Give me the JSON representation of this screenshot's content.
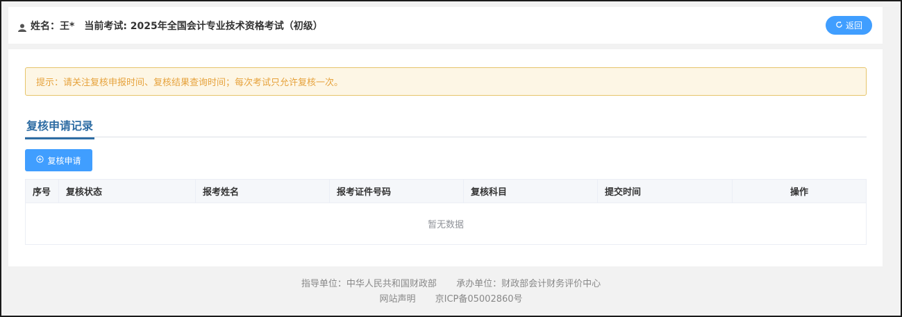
{
  "header": {
    "name_label": "姓名：王*",
    "exam_label": "当前考试: 2025年全国会计专业技术资格考试（初级）",
    "back_label": "返回"
  },
  "notice": {
    "text": "提示：请关注复核申报时间、复核结果查询时间；每次考试只允许复核一次。"
  },
  "tab": {
    "title": "复核申请记录"
  },
  "actions": {
    "apply_label": "复核申请"
  },
  "table": {
    "columns": [
      "序号",
      "复核状态",
      "报考姓名",
      "报考证件号码",
      "复核科目",
      "提交时间",
      "操作"
    ],
    "empty_text": "暂无数据"
  },
  "footer": {
    "guide_unit": "指导单位：中华人民共和国财政部",
    "host_unit": "承办单位：财政部会计财务评价中心",
    "statement": "网站声明",
    "icp": "京ICP备05002860号"
  },
  "colors": {
    "primary": "#409eff",
    "tab_accent": "#2d6ca3",
    "notice_text": "#e6a23c",
    "notice_bg": "#fdf6e5"
  }
}
